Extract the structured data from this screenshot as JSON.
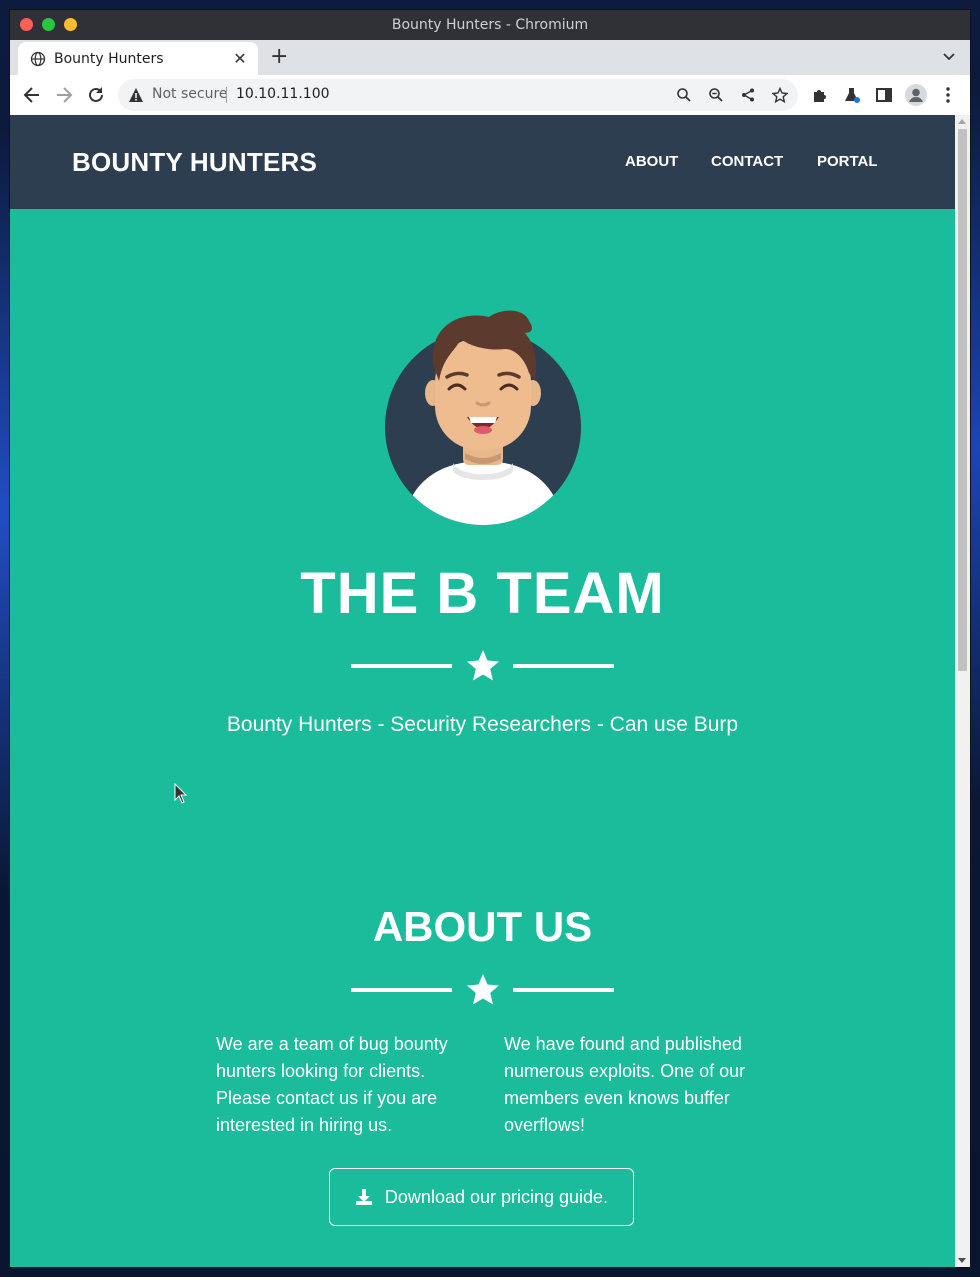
{
  "window": {
    "title": "Bounty Hunters - Chromium"
  },
  "tabs": [
    {
      "label": "Bounty Hunters",
      "icon": "globe-icon"
    }
  ],
  "toolbar": {
    "security_label": "Not secure",
    "url": "10.10.11.100"
  },
  "navbar": {
    "brand": "BOUNTY HUNTERS",
    "links": [
      {
        "label": "ABOUT"
      },
      {
        "label": "CONTACT"
      },
      {
        "label": "PORTAL"
      }
    ]
  },
  "hero": {
    "title": "THE B TEAM",
    "tagline": "Bounty Hunters - Security Researchers - Can use Burp"
  },
  "about": {
    "title": "ABOUT US",
    "col_left": "We are a team of bug bounty hunters looking for clients. Please contact us if you are interested in hiring us.",
    "col_right": "We have found and published numerous exploits. One of our members even knows buffer overflows!",
    "download_label": "Download our pricing guide."
  },
  "colors": {
    "navbar_bg": "#2c3e50",
    "page_bg": "#1abc9c",
    "text": "#ffffff"
  }
}
